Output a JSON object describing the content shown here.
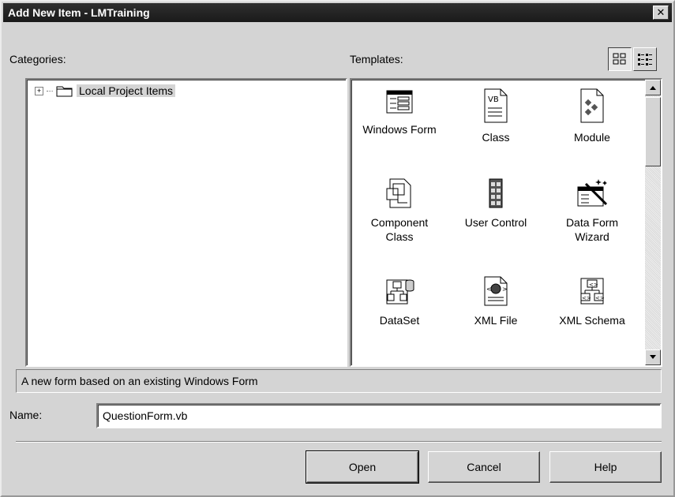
{
  "window": {
    "title": "Add New Item - LMTraining",
    "close_glyph": "✕"
  },
  "categories": {
    "label": "Categories:",
    "tree": [
      {
        "expander": "+",
        "icon": "folder-icon",
        "label": "Local Project Items",
        "selected": true
      }
    ]
  },
  "templates": {
    "label": "Templates:",
    "view_modes": [
      {
        "icon": "large-icons-view-icon",
        "active": true
      },
      {
        "icon": "small-icons-view-icon",
        "active": false
      }
    ],
    "items": [
      {
        "label": "Windows Form",
        "icon": "windows-form-icon"
      },
      {
        "label": "Class",
        "icon": "class-icon"
      },
      {
        "label": "Module",
        "icon": "module-icon"
      },
      {
        "label": "Component\nClass",
        "icon": "component-class-icon"
      },
      {
        "label": "User Control",
        "icon": "user-control-icon"
      },
      {
        "label": "Data Form\nWizard",
        "icon": "data-form-wizard-icon"
      },
      {
        "label": "DataSet",
        "icon": "dataset-icon"
      },
      {
        "label": "XML File",
        "icon": "xml-file-icon"
      },
      {
        "label": "XML Schema",
        "icon": "xml-schema-icon"
      }
    ]
  },
  "description": "A new form based on an existing Windows Form",
  "name_field": {
    "label": "Name:",
    "value": "QuestionForm.vb"
  },
  "buttons": {
    "open": "Open",
    "cancel": "Cancel",
    "help": "Help"
  }
}
